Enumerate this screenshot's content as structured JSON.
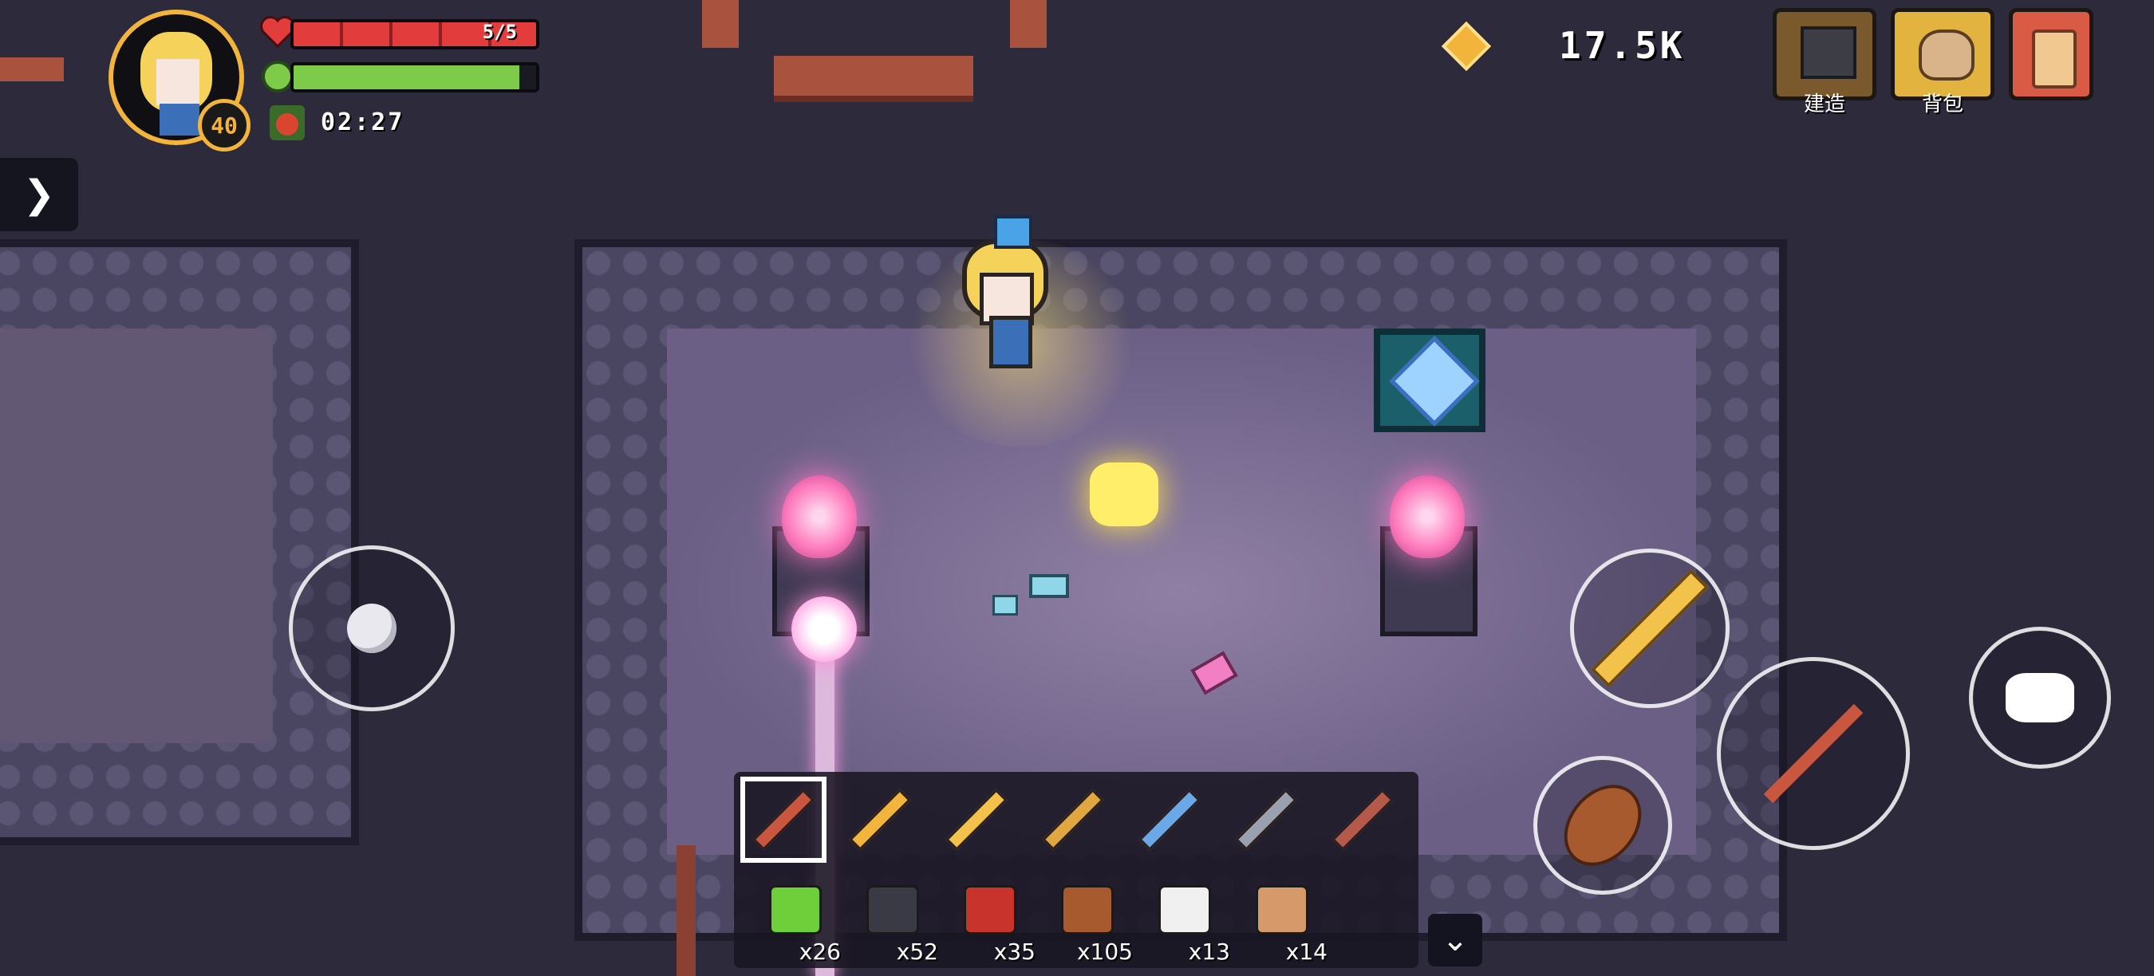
{
  "hud": {
    "level": "40",
    "health_text": "5/5",
    "health_fraction": 1.0,
    "energy_fraction": 0.93,
    "timer": "02:27",
    "currency": "17.5K"
  },
  "top_buttons": [
    {
      "label": "建造",
      "icon": "build-icon",
      "color": "#7a5a2c"
    },
    {
      "label": "背包",
      "icon": "backpack-icon",
      "color": "#e2b33e"
    },
    {
      "label": "",
      "icon": "scroll-icon",
      "color": "#d95a45"
    }
  ],
  "hotbar": {
    "tools": [
      {
        "icon": "pickaxe-icon",
        "selected": true
      },
      {
        "icon": "shovel-icon",
        "selected": false
      },
      {
        "icon": "golden-sword-icon",
        "selected": false
      },
      {
        "icon": "spear-icon",
        "selected": false
      },
      {
        "icon": "ice-wand-icon",
        "selected": false
      },
      {
        "icon": "hammer-icon",
        "selected": false
      },
      {
        "icon": "fishing-rod-icon",
        "selected": false
      }
    ],
    "items": [
      {
        "icon": "grass-block-icon",
        "qty": "x26"
      },
      {
        "icon": "jar-icon",
        "qty": "x52"
      },
      {
        "icon": "berries-icon",
        "qty": "x35"
      },
      {
        "icon": "cooked-fish-icon",
        "qty": "x105"
      },
      {
        "icon": "sushi-icon",
        "qty": "x13"
      },
      {
        "icon": "bread-icon",
        "qty": "x14"
      }
    ]
  },
  "colors": {
    "health": "#e23c3c",
    "energy": "#7ecb4a",
    "gold": "#f2b43a",
    "flame": "#ff7fbf"
  }
}
